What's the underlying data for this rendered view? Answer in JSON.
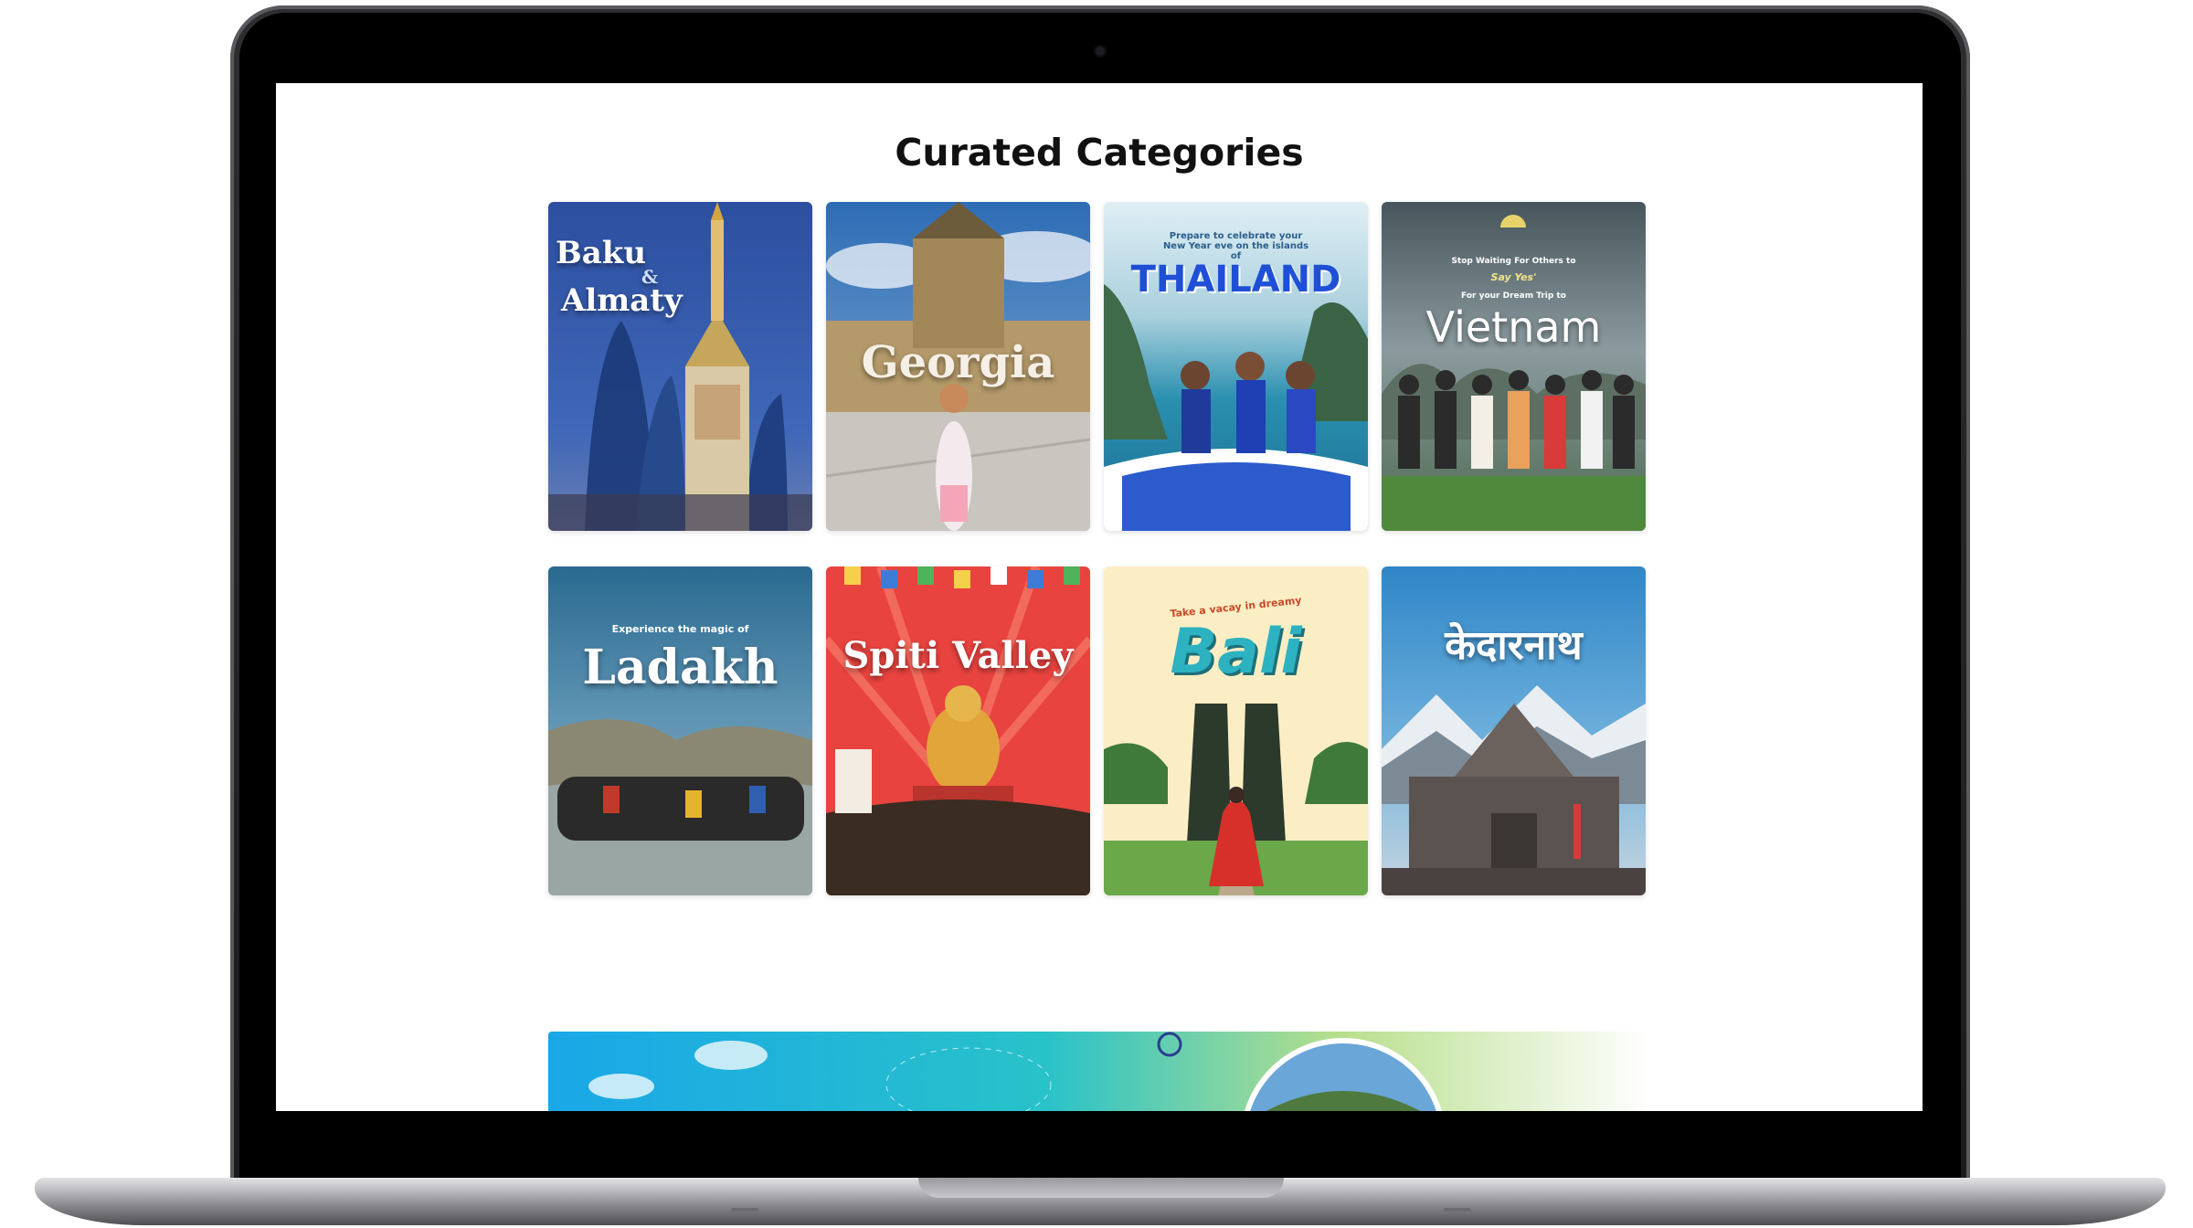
{
  "page": {
    "title": "Curated Categories"
  },
  "categories": [
    {
      "label": "Baku",
      "label2": "&",
      "label3": "Almaty",
      "subtitle": ""
    },
    {
      "label": "Georgia",
      "subtitle": ""
    },
    {
      "label": "THAILAND",
      "subtitle": "Prepare to celebrate your New Year eve on the islands of"
    },
    {
      "label": "Vietnam",
      "subtitle": "Stop Waiting For Others to",
      "subtitle2": "Say Yes'",
      "subtitle3": "For your Dream Trip to"
    },
    {
      "label": "Ladakh",
      "subtitle": "Experience the magic of"
    },
    {
      "label": "Spiti Valley",
      "subtitle": ""
    },
    {
      "label": "Bali",
      "subtitle": "Take a vacay in dreamy"
    },
    {
      "label": "केदारनाथ",
      "subtitle": ""
    }
  ],
  "colors": {
    "title": "#111111",
    "baku_bg": "#2d4f9c",
    "georgia_sky": "#2f6fb7",
    "thailand_sea": "#2a8fb0",
    "vietnam_bg": "#5f6f76",
    "ladakh_sky": "#2f6f96",
    "spiti_bg": "#e8433f",
    "bali_bg": "#fbeec4",
    "kedarnath_sky": "#3a8fd0"
  }
}
